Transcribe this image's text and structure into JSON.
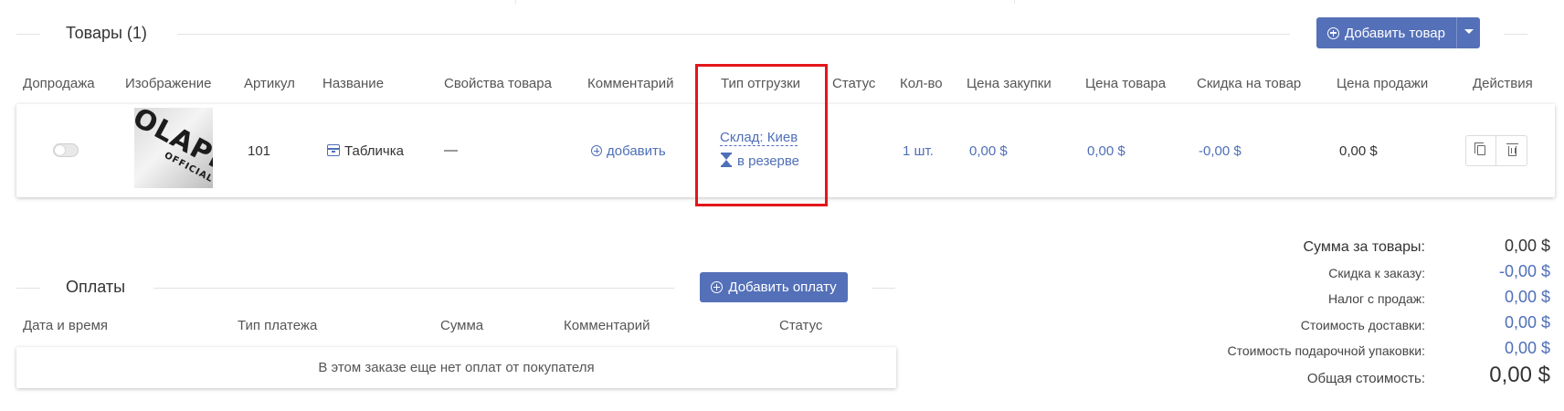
{
  "products": {
    "title": "Товары (1)",
    "add_button": "Добавить товар",
    "columns": [
      "Допродажа",
      "Изображение",
      "Артикул",
      "Название",
      "Свойства товара",
      "Комментарий",
      "Тип отгрузки",
      "Статус",
      "Кол-во",
      "Цена закупки",
      "Цена товара",
      "Скидка на товар",
      "Цена продажи",
      "Действия"
    ],
    "row": {
      "image_brand": "OLAPL",
      "image_sub": "OFFICIAL",
      "sku": "101",
      "name": "Табличка",
      "properties": "—",
      "comment_link": "добавить",
      "warehouse": "Склад: Киев",
      "reserve": "в резерве",
      "quantity": "1 шт.",
      "purchase_price": "0,00 $",
      "item_price": "0,00 $",
      "item_discount": "-0,00 $",
      "sale_price": "0,00 $"
    }
  },
  "payments": {
    "title": "Оплаты",
    "add_button": "Добавить оплату",
    "columns": [
      "Дата и время",
      "Тип платежа",
      "Сумма",
      "Комментарий",
      "Статус"
    ],
    "empty_message": "В этом заказе еще нет оплат от покупателя"
  },
  "summary": [
    {
      "label": "Сумма за товары:",
      "value": "0,00 $",
      "color": "#333333"
    },
    {
      "label": "Скидка к заказу:",
      "value": "-0,00 $",
      "color": "#4f6fb8"
    },
    {
      "label": "Налог с продаж:",
      "value": "0,00 $",
      "color": "#4f6fb8"
    },
    {
      "label": "Стоимость доставки:",
      "value": "0,00 $",
      "color": "#4f6fb8"
    },
    {
      "label": "Стоимость подарочной упаковки:",
      "value": "0,00 $",
      "color": "#4f6fb8"
    },
    {
      "label": "Общая стоимость:",
      "value": "0,00 $",
      "color": "#333333"
    }
  ],
  "colors": {
    "primary_button": "#5470b8",
    "link": "#4f6fb8",
    "highlight": "#e3161b"
  }
}
